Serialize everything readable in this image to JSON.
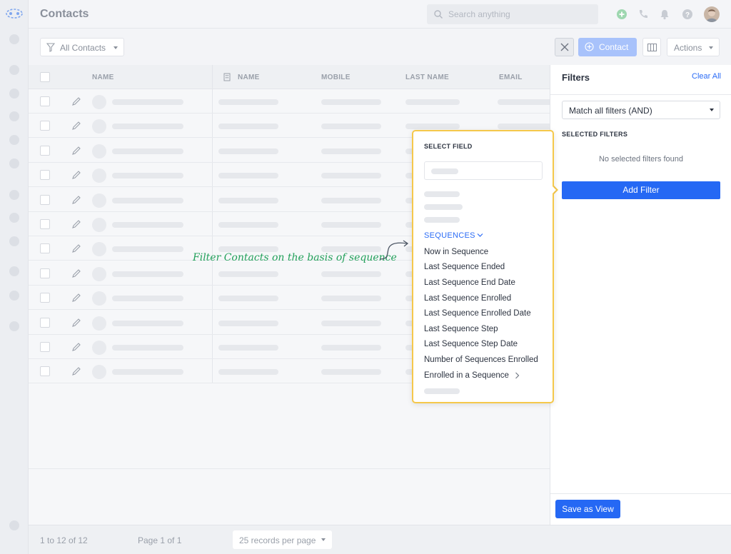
{
  "app": {
    "title": "Contacts"
  },
  "search": {
    "placeholder": "Search anything"
  },
  "toolbar": {
    "filter_label": "All Contacts",
    "contact_label": "Contact",
    "actions_label": "Actions"
  },
  "table": {
    "headers": [
      "NAME",
      "NAME",
      "MOBILE",
      "LAST NAME",
      "EMAIL"
    ],
    "row_count": 12
  },
  "footer": {
    "range": "1 to 12 of 12",
    "page": "Page 1 of 1",
    "per_page": "25 records per page"
  },
  "filters_panel": {
    "title": "Filters",
    "clear_all": "Clear All",
    "match_mode": "Match all filters (AND)",
    "selected_heading": "SELECTED FILTERS",
    "empty_text": "No selected filters found",
    "add_filter": "Add Filter",
    "save_view": "Save as View"
  },
  "select_field": {
    "heading": "SELECT FIELD",
    "section": "SEQUENCES",
    "items": [
      "Now in Sequence",
      "Last Sequence Ended",
      "Last Sequence End Date",
      "Last Sequence Enrolled",
      "Last Sequence Enrolled Date",
      "Last Sequence Step",
      "Last Sequence Step Date",
      "Number of Sequences Enrolled",
      "Enrolled in a Sequence"
    ]
  },
  "annotation": "Filter Contacts on the basis of sequence",
  "colors": {
    "accent": "#2568f4",
    "highlight": "#f5c84b",
    "annotation": "#22a05a"
  }
}
